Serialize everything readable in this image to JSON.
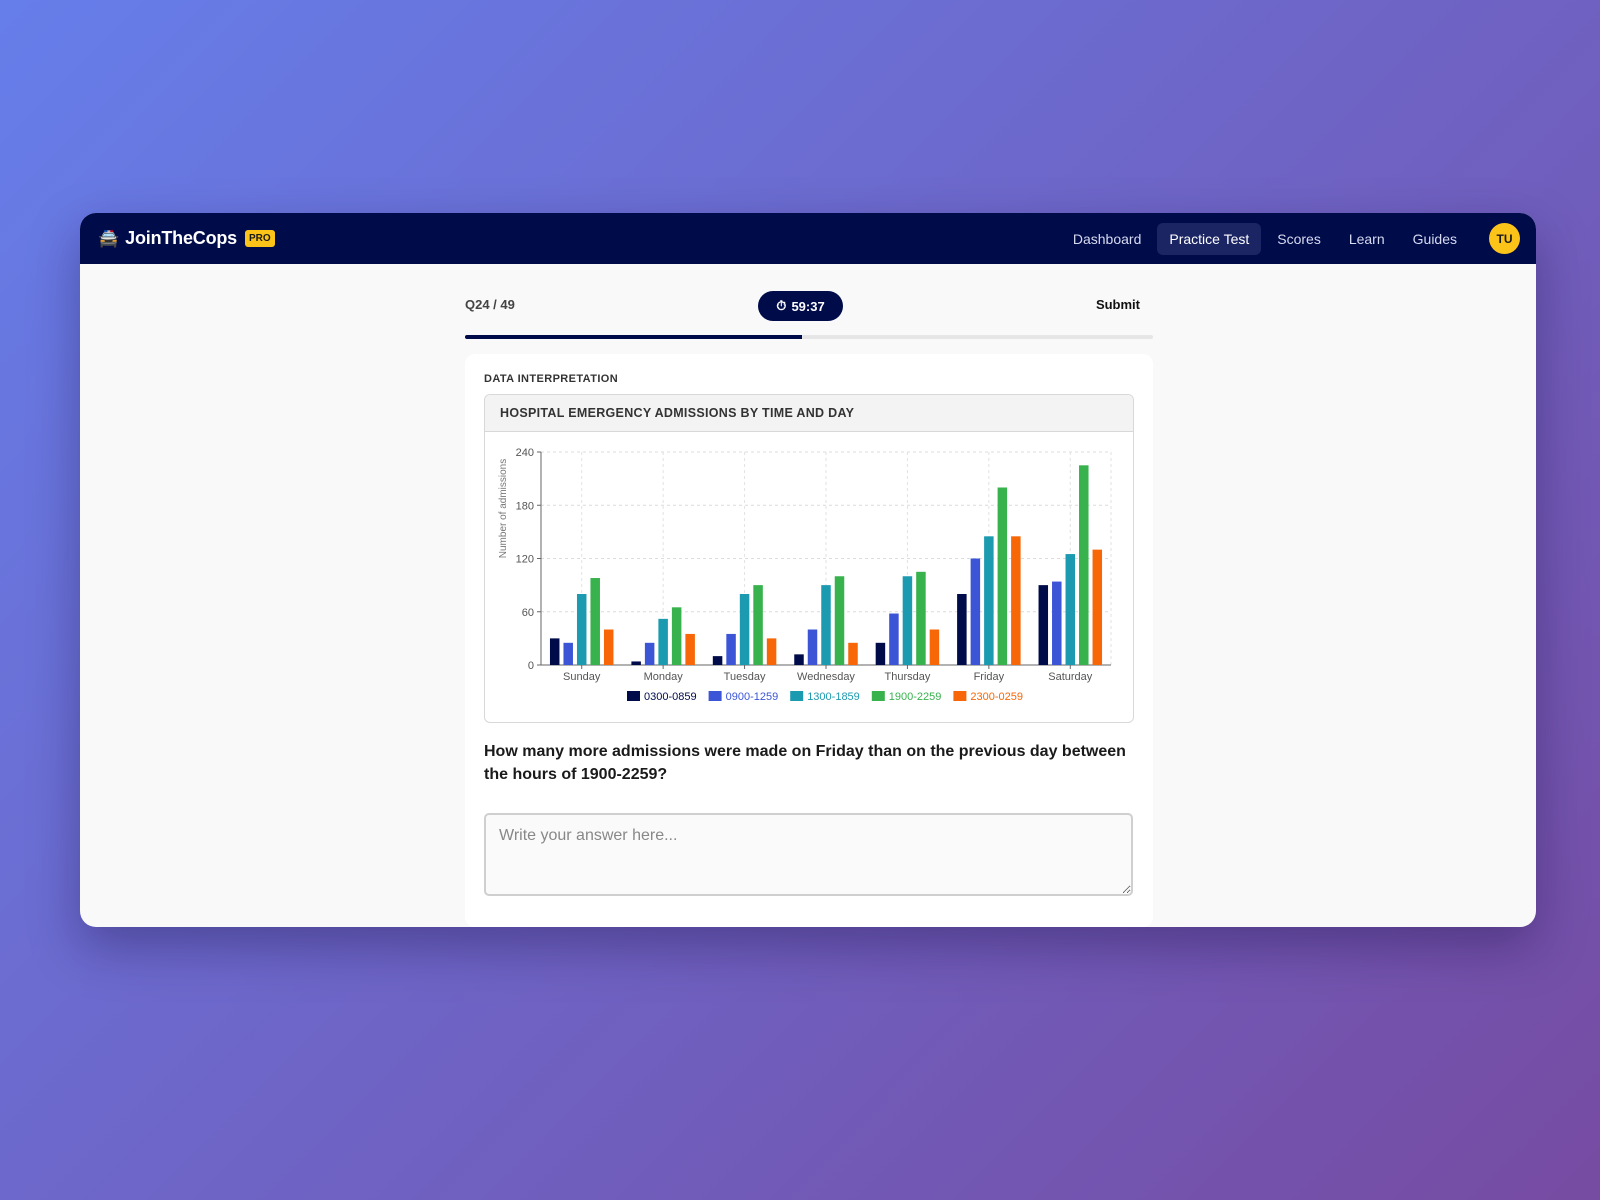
{
  "nav": {
    "brand_icon": "🚔",
    "brand": "JoinTheCops",
    "badge": "PRO",
    "links": [
      {
        "label": "Dashboard",
        "active": false
      },
      {
        "label": "Practice Test",
        "active": true
      },
      {
        "label": "Scores",
        "active": false
      },
      {
        "label": "Learn",
        "active": false
      },
      {
        "label": "Guides",
        "active": false
      }
    ],
    "avatar": "TU"
  },
  "test": {
    "counter": "Q24 / 49",
    "timer_icon": "⏱",
    "timer": "59:37",
    "submit": "Submit",
    "progress": 0.49
  },
  "question": {
    "category": "DATA INTERPRETATION",
    "chart_title": "HOSPITAL EMERGENCY ADMISSIONS BY TIME AND DAY",
    "text": "How many more admissions were made on Friday than on the previous day between the hours of 1900-2259?",
    "answer_placeholder": "Write your answer here...",
    "answer_value": ""
  },
  "chart_data": {
    "type": "bar",
    "title": "HOSPITAL EMERGENCY ADMISSIONS BY TIME AND DAY",
    "xlabel": "",
    "ylabel": "Number of admissions",
    "categories": [
      "Sunday",
      "Monday",
      "Tuesday",
      "Wednesday",
      "Thursday",
      "Friday",
      "Saturday"
    ],
    "ylim": [
      0,
      240
    ],
    "yticks": [
      0,
      60,
      120,
      180,
      240
    ],
    "grid": true,
    "legend_position": "bottom",
    "series": [
      {
        "name": "0300-0859",
        "color": "#000b4a",
        "values": [
          30,
          4,
          10,
          12,
          25,
          80,
          90
        ]
      },
      {
        "name": "0900-1259",
        "color": "#3b55d6",
        "values": [
          25,
          25,
          35,
          40,
          58,
          120,
          94
        ]
      },
      {
        "name": "1300-1859",
        "color": "#1c9ab0",
        "values": [
          80,
          52,
          80,
          90,
          100,
          145,
          125
        ]
      },
      {
        "name": "1900-2259",
        "color": "#37b24d",
        "values": [
          98,
          65,
          90,
          100,
          105,
          200,
          225
        ]
      },
      {
        "name": "2300-0259",
        "color": "#f76707",
        "values": [
          40,
          35,
          30,
          25,
          40,
          145,
          130
        ]
      }
    ]
  }
}
